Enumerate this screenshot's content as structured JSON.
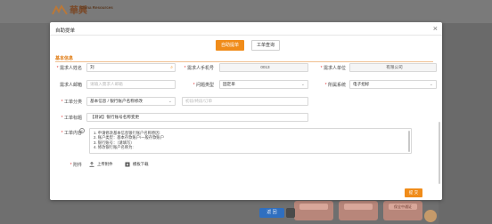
{
  "brand": {
    "name_cn": "華興",
    "name_en": "China Resources"
  },
  "background": {
    "bottom_button": "返 回",
    "cards": [
      "",
      "",
      "保全中通证"
    ]
  },
  "modal": {
    "title": "自助提单",
    "close": "×",
    "tabs": [
      {
        "label": "自助提单"
      },
      {
        "label": "工单查询"
      }
    ],
    "section_title": "基本信息",
    "fields": {
      "requester_name": {
        "label": "需求人姓名",
        "value": "刘"
      },
      "requester_phone": {
        "label": "需求人手机号",
        "value": "0013"
      },
      "requester_unit": {
        "label": "需求人单位",
        "value": "有限公司"
      },
      "requester_email": {
        "label": "需求人邮箱",
        "placeholder": "请输入需求人邮箱"
      },
      "issue_type": {
        "label": "问题类型",
        "value": "固定单"
      },
      "system": {
        "label": "所属系统",
        "value": "电子招标"
      },
      "ticket_category": {
        "label": "工单分类",
        "value": "基本信息 / 银行账户名称修改"
      },
      "category_path": {
        "label": "",
        "placeholder": "初段/终段/订单"
      },
      "ticket_title": {
        "label": "工单标题",
        "value": "【测试】银行账号名称变更"
      },
      "ticket_content": {
        "label": "工单内容",
        "lines": [
          "1. 申请修改基本信息银行账户名称原因:",
          "2. 账户类型：基本存款账户/一般存款账户",
          "3. 银行账号：（请填写）",
          "4. 修改银行账户名称为:"
        ]
      },
      "attachment": {
        "label": "附件",
        "upload": "上传附件",
        "template": "模板下载"
      }
    },
    "submit": "提 交"
  }
}
